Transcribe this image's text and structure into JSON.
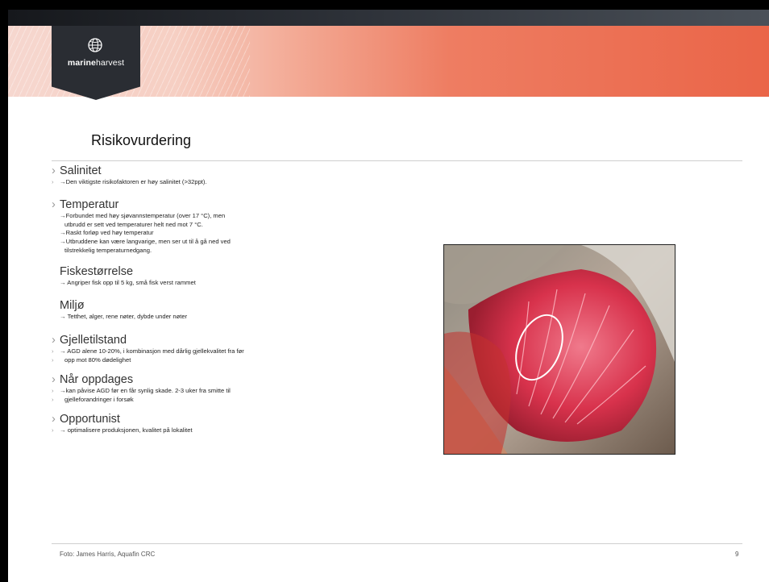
{
  "logo": {
    "bold": "marine",
    "regular": "harvest"
  },
  "slide": {
    "title": "Risikovurdering",
    "sections": {
      "salinitet": {
        "heading": "Salinitet",
        "lines": [
          "→Den viktigste risikofaktoren er høy salinitet (>32ppt)."
        ]
      },
      "temperatur": {
        "heading": "Temperatur",
        "lines": [
          "→Forbundet med høy sjøvannstemperatur (over 17 °C), men",
          "utbrudd er sett ved temperaturer helt ned mot 7 °C.",
          "→Raskt forløp ved høy temperatur",
          "→Utbruddene kan være langvarige, men ser ut til å gå ned ved",
          "tilstrekkelig temperaturnedgang."
        ]
      },
      "fisk": {
        "heading": "Fiskestørrelse",
        "lines": [
          "→ Angriper fisk opp til 5 kg, små fisk verst rammet"
        ]
      },
      "miljo": {
        "heading": "Miljø",
        "lines": [
          "→ Tetthet, alger, rene nøter, dybde under nøter"
        ]
      },
      "gjelle": {
        "heading": "Gjelletilstand",
        "lines": [
          "→ AGD alene 10-20%, i kombinasjon med dårlig gjellekvalitet fra før",
          "opp mot 80% dødelighet"
        ]
      },
      "naar": {
        "heading": "Når oppdages",
        "lines": [
          "→kan påvise AGD før en får synlig skade. 2-3 uker fra smitte til",
          "gjelleforandringer i forsøk"
        ]
      },
      "opp": {
        "heading": "Opportunist",
        "lines": [
          "→ optimalisere produksjonen, kvalitet på lokalitet"
        ]
      }
    },
    "bullet_glyph": "›"
  },
  "footer": {
    "credit": "Foto: James Harris, Aquafin CRC",
    "page_number": "9"
  },
  "colors": {
    "banner_start": "#f6d7cf",
    "banner_end": "#ea6548",
    "logo_bg": "#2a2d33",
    "gill_red": "#d8324c"
  }
}
